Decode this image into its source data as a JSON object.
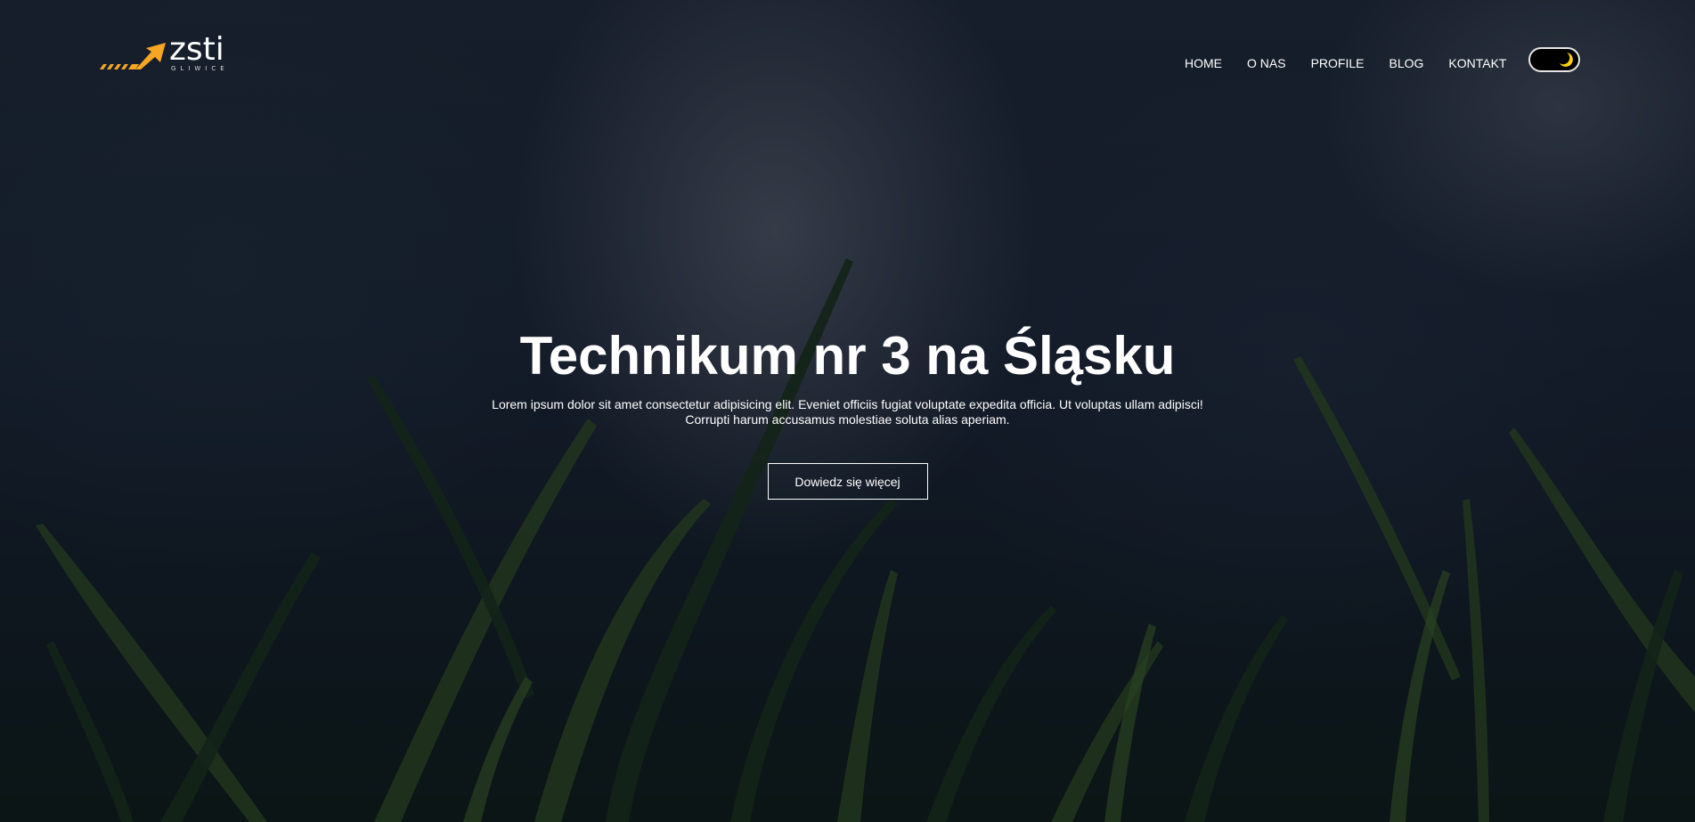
{
  "logo": {
    "name": "zsti",
    "subtitle": "GLIWICE",
    "accent": "#f5a623"
  },
  "nav": {
    "items": [
      {
        "label": "HOME"
      },
      {
        "label": "O NAS"
      },
      {
        "label": "PROFILE"
      },
      {
        "label": "BLOG"
      },
      {
        "label": "KONTAKT"
      }
    ],
    "theme_toggle": {
      "icon": "moon-icon",
      "state": "dark",
      "icon_color": "#ffd000"
    }
  },
  "hero": {
    "title": "Technikum nr 3 na Śląsku",
    "description_line1": "Lorem ipsum dolor sit amet consectetur adipisicing elit. Eveniet officiis fugiat voluptate expedita officia. Ut voluptas ullam adipisci!",
    "description_line2": "Corrupti harum accusamus molestiae soluta alias aperiam.",
    "cta_label": "Dowiedz się więcej"
  }
}
